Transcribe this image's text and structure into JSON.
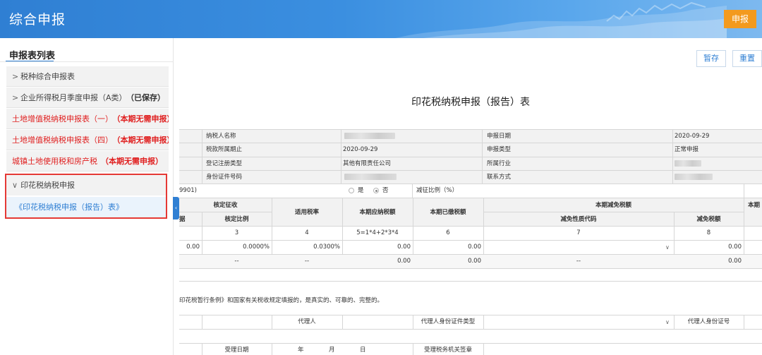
{
  "header": {
    "title": "综合申报",
    "submit_label": "申报"
  },
  "sidebar": {
    "title": "申报表列表",
    "items": [
      {
        "label": "税种综合申报表",
        "status": "",
        "chev": ">",
        "red": false
      },
      {
        "label": "企业所得税月季度申报（A类）",
        "status": "（已保存）",
        "chev": ">",
        "red": false
      },
      {
        "label": "土地增值税纳税申报表（一）",
        "status": "（本期无需申报）",
        "chev": "",
        "red": true
      },
      {
        "label": "土地增值税纳税申报表（四）",
        "status": "（本期无需申报）",
        "chev": "",
        "red": true
      },
      {
        "label": "城镇土地使用税和房产税",
        "status": "（本期无需申报）",
        "chev": "",
        "red": true
      }
    ],
    "group": {
      "chev": "∨",
      "label": "印花税纳税申报",
      "sub_item": "《印花税纳税申报（报告）表》"
    },
    "collapse_glyph": "‹"
  },
  "toolbar": {
    "save_label": "暂存",
    "reset_label": "重置"
  },
  "form": {
    "title": "印花税纳税申报（报告）表",
    "info": {
      "taxpayer_name_label": "纳税人名称",
      "period_end_label": "税款所属期止",
      "period_end_value": "2020-09-29",
      "reg_type_label": "登记注册类型",
      "reg_type_value": "其他有限责任公司",
      "id_label": "身份证件号码",
      "declare_date_label": "申报日期",
      "declare_date_value": "2020-09-29",
      "declare_type_label": "申报类型",
      "declare_type_value": "正常申报",
      "industry_label": "所属行业",
      "contact_label": "联系方式"
    },
    "reduction": {
      "code_tail": "9901)",
      "yes_label": "是",
      "no_label": "否",
      "ratio_label": "减征比例（%）"
    },
    "table": {
      "h_verified": "核定征收",
      "h_basis": "据",
      "h_verified_ratio": "核定比例",
      "h_rate": "适用税率",
      "h_payable": "本期应纳税额",
      "h_paid": "本期已缴税额",
      "h_reduction": "本期减免税额",
      "h_reduction_code": "减免性质代码",
      "h_reduction_amount": "减免税额",
      "h_next": "本期",
      "idx_3": "3",
      "idx_4": "4",
      "idx_5": "5=1*4+2*3*4",
      "idx_6": "6",
      "idx_7": "7",
      "idx_8": "8",
      "r1_basis": "0.00",
      "r1_ratio": "0.0000%",
      "r1_rate": "0.0300%",
      "r1_payable": "0.00",
      "r1_paid": "0.00",
      "r1_reduction": "0.00",
      "r2_ratio": "--",
      "r2_rate": "--",
      "r2_payable": "0.00",
      "r2_paid": "0.00",
      "r2_code": "--",
      "r2_reduction": "0.00"
    },
    "declaration": "印花税暂行条例》和国家有关税收规定填报的，是真实的、可靠的、完整的。",
    "agent": {
      "agent_label": "代理人",
      "agent_id_type_label": "代理人身份证件类型",
      "agent_id_label": "代理人身份证号"
    },
    "accept": {
      "date_label": "受理日期",
      "year": "年",
      "month": "月",
      "day": "日",
      "authority_label": "受理税务机关签章"
    }
  },
  "colors": {
    "accent": "#2f7fd3",
    "submit": "#f39a1e",
    "alert": "#e02020"
  }
}
